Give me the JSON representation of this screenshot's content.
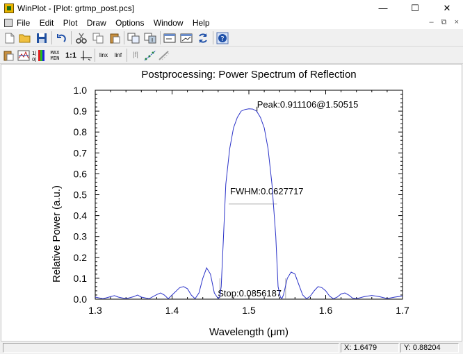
{
  "window": {
    "title": "WinPlot - [Plot: grtmp_post.pcs]",
    "minimize": "—",
    "maximize": "☐",
    "close": "✕"
  },
  "menu": {
    "items": [
      "File",
      "Edit",
      "Plot",
      "Draw",
      "Options",
      "Window",
      "Help"
    ],
    "mdi": [
      "–",
      "⧉",
      "×"
    ]
  },
  "toolbar2_labels": {
    "axes": "1:1",
    "maxmin_top": "MAX",
    "maxmin_bot": "MIN",
    "linx": "linx",
    "linf": "linf",
    "ratio_top": "1|",
    "ratio_bot": "0|",
    "f": "|f|"
  },
  "chart_data": {
    "type": "line",
    "title": "Postprocessing: Power Spectrum of Reflection",
    "xlabel": "Wavelength (μm)",
    "ylabel": "Relative Power (a.u.)",
    "xlim": [
      1.3,
      1.7
    ],
    "ylim": [
      0.0,
      1.0
    ],
    "xticks": [
      "1.3",
      "1.4",
      "1.5",
      "1.6",
      "1.7"
    ],
    "yticks": [
      "0.0",
      "0.1",
      "0.2",
      "0.3",
      "0.4",
      "0.5",
      "0.6",
      "0.7",
      "0.8",
      "0.9",
      "1.0"
    ],
    "line_color": "#2a32c8",
    "series": [
      {
        "x": [
          1.3,
          1.31,
          1.32,
          1.325,
          1.33,
          1.34,
          1.35,
          1.355,
          1.36,
          1.37,
          1.38,
          1.385,
          1.39,
          1.395,
          1.4,
          1.41,
          1.415,
          1.42,
          1.425,
          1.43,
          1.435,
          1.44,
          1.445,
          1.45,
          1.455,
          1.46,
          1.462,
          1.464,
          1.467,
          1.47,
          1.475,
          1.48,
          1.485,
          1.49,
          1.495,
          1.5,
          1.505,
          1.51,
          1.515,
          1.52,
          1.525,
          1.53,
          1.535,
          1.538,
          1.541,
          1.543,
          1.545,
          1.55,
          1.555,
          1.56,
          1.565,
          1.57,
          1.575,
          1.58,
          1.585,
          1.59,
          1.595,
          1.6,
          1.605,
          1.61,
          1.615,
          1.62,
          1.625,
          1.63,
          1.635,
          1.64,
          1.65,
          1.66,
          1.67,
          1.68,
          1.69,
          1.7
        ],
        "y": [
          0.01,
          0.002,
          0.012,
          0.017,
          0.01,
          0.002,
          0.012,
          0.02,
          0.01,
          0.002,
          0.022,
          0.03,
          0.02,
          0.002,
          0.02,
          0.055,
          0.06,
          0.05,
          0.02,
          0.002,
          0.03,
          0.1,
          0.15,
          0.12,
          0.03,
          0.003,
          0.01,
          0.06,
          0.3,
          0.55,
          0.72,
          0.82,
          0.87,
          0.9,
          0.908,
          0.911,
          0.91,
          0.9,
          0.87,
          0.82,
          0.72,
          0.55,
          0.3,
          0.06,
          0.01,
          0.003,
          0.02,
          0.1,
          0.13,
          0.12,
          0.07,
          0.02,
          0.002,
          0.015,
          0.04,
          0.06,
          0.055,
          0.04,
          0.015,
          0.002,
          0.01,
          0.025,
          0.03,
          0.02,
          0.005,
          0.002,
          0.012,
          0.018,
          0.012,
          0.003,
          0.01,
          0.015
        ]
      }
    ],
    "annotations": {
      "peak": {
        "text": "Peak:0.911106@1.50515",
        "x": 1.50515,
        "y": 0.911106
      },
      "fwhm": {
        "text": "FWHM:0.0627717",
        "y": 0.4556,
        "x1": 1.4738,
        "x2": 1.5366
      },
      "stop": {
        "text": "Stop:0.0856187",
        "y": 0.0,
        "x1": 1.4622,
        "x2": 1.5478
      }
    }
  },
  "status": {
    "left": "",
    "x": "X: 1.6479",
    "y": "Y: 0.88204"
  }
}
